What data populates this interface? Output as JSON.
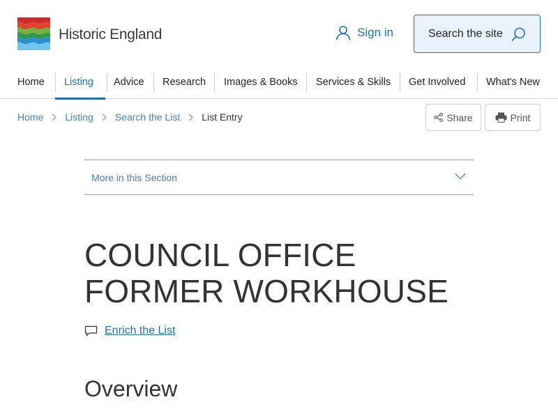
{
  "header": {
    "logo_text": "Historic England",
    "signin_label": "Sign in",
    "search_label": "Search the site"
  },
  "nav": {
    "items": [
      {
        "label": "Home"
      },
      {
        "label": "Listing"
      },
      {
        "label": "Advice"
      },
      {
        "label": "Research"
      },
      {
        "label": "Images & Books"
      },
      {
        "label": "Services & Skills"
      },
      {
        "label": "Get Involved"
      },
      {
        "label": "What's New"
      }
    ],
    "active": "Listing"
  },
  "breadcrumb": {
    "items": [
      {
        "label": "Home"
      },
      {
        "label": "Listing"
      },
      {
        "label": "Search the List"
      },
      {
        "label": "List Entry"
      }
    ]
  },
  "actions": {
    "share_label": "Share",
    "print_label": "Print"
  },
  "section": {
    "more_label": "More in this Section"
  },
  "page": {
    "title": "COUNCIL OFFICE FORMER WORKHOUSE",
    "enrich_label": "Enrich the List",
    "overview_heading": "Overview"
  },
  "icons": {
    "user": "user-icon",
    "search": "search-icon",
    "share": "share-icon",
    "print": "print-icon",
    "chevron_right": "chevron-right-icon",
    "chevron_down": "chevron-down-icon",
    "comment": "comment-icon"
  },
  "colors": {
    "accent": "#1f6fb5",
    "link": "#4a7fae",
    "text": "#333333",
    "search_bg": "#e9f2fb"
  }
}
